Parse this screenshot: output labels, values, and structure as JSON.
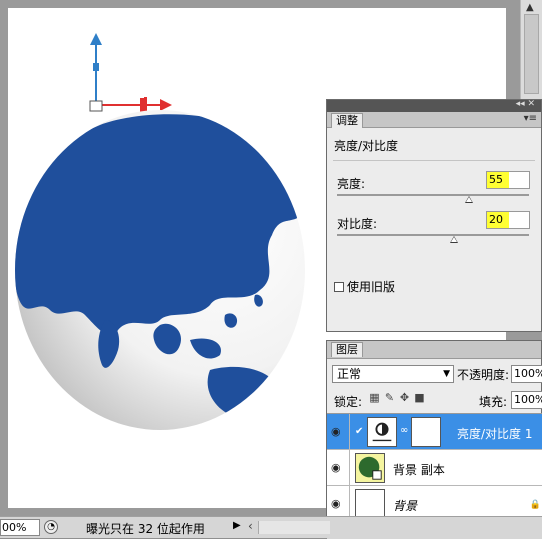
{
  "colors": {
    "globe_land": "#1f4f9c",
    "highlight_yellow": "#ffff33",
    "selected_layer": "#3b8fe6",
    "gizmo_y": "#2f7fc8",
    "gizmo_x": "#e03030"
  },
  "adjustments_panel": {
    "tab_label": "调整",
    "heading": "亮度/对比度",
    "brightness_label": "亮度:",
    "brightness_value": "55",
    "contrast_label": "对比度:",
    "contrast_value": "20",
    "legacy_label": "使用旧版"
  },
  "layers_panel": {
    "tab_label": "图层",
    "blend_mode": "正常",
    "opacity_label": "不透明度:",
    "opacity_value": "100%",
    "lock_label": "锁定:",
    "fill_label": "填充:",
    "fill_value": "100%",
    "layers": [
      {
        "name": "亮度/对比度 1",
        "selected": true
      },
      {
        "name": "背景 副本",
        "selected": false
      },
      {
        "name": "背景",
        "selected": false
      }
    ]
  },
  "status_bar": {
    "zoom": "00%",
    "message": "曝光只在 32 位起作用"
  }
}
